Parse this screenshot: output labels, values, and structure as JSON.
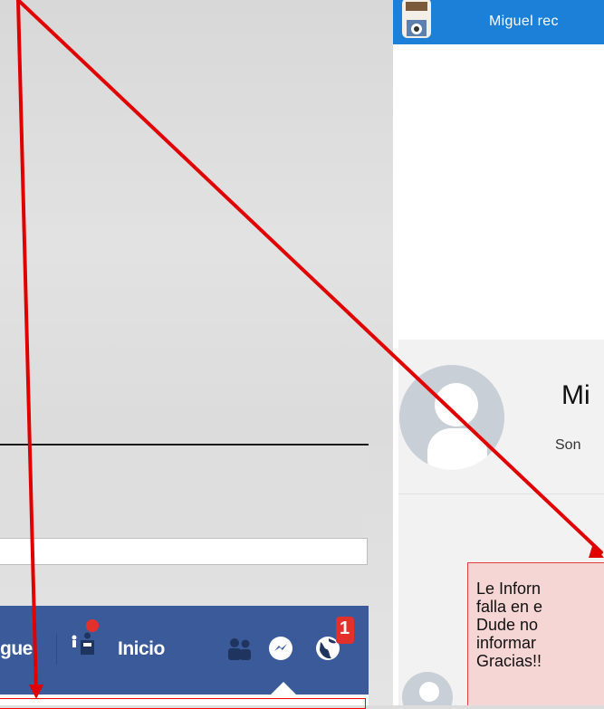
{
  "left_panel": {
    "nav": {
      "user_label": "guel",
      "home_label": "Inicio",
      "notification_count": "1"
    }
  },
  "right_panel": {
    "topbar_text": "Miguel rec",
    "profile_name": "Mi",
    "profile_subtitle": "Son",
    "message_lines": [
      "Le Inforn",
      "falla en e",
      "Dude no",
      "informar",
      "Gracias!!"
    ]
  },
  "colors": {
    "facebook_blue": "#3b5a9a",
    "topbar_blue": "#1c7fd8",
    "arrow_red": "#e00000",
    "message_pink": "#f6d5d5"
  }
}
